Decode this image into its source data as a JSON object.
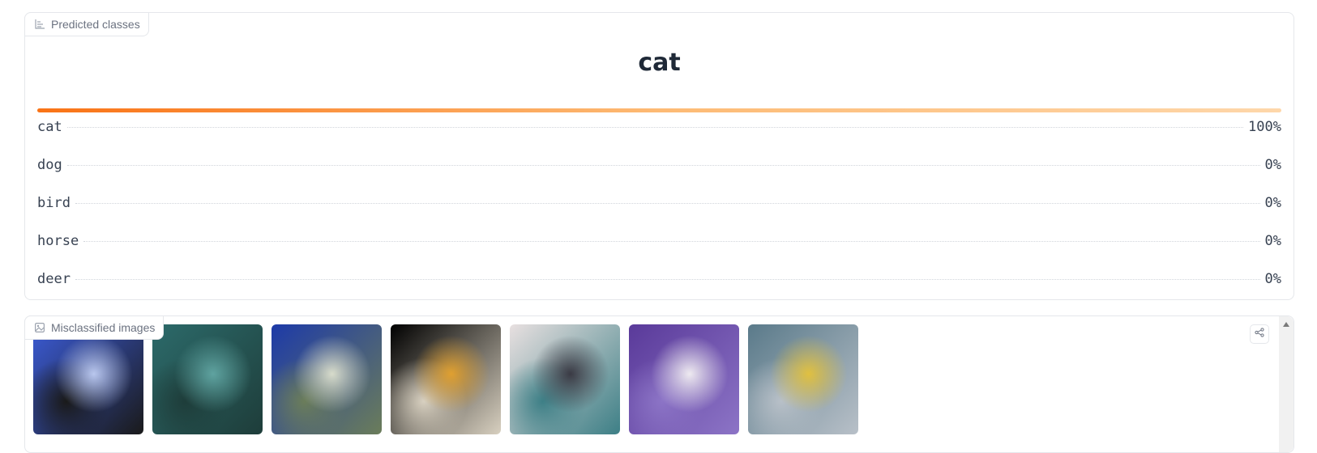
{
  "predicted": {
    "label": "Predicted classes",
    "icon": "bar-chart-icon",
    "top_class": "cat",
    "confidences": [
      {
        "label": "cat",
        "percent": "100%",
        "value": 1.0
      },
      {
        "label": "dog",
        "percent": "0%",
        "value": 0.0
      },
      {
        "label": "bird",
        "percent": "0%",
        "value": 0.0
      },
      {
        "label": "horse",
        "percent": "0%",
        "value": 0.0
      },
      {
        "label": "deer",
        "percent": "0%",
        "value": 0.0
      }
    ]
  },
  "misclassified": {
    "label": "Misclassified images",
    "icon": "image-icon",
    "share_icon": "share-icon",
    "images": [
      {
        "name": "misclassified-image-1",
        "colors": [
          "#3b5bd6",
          "#b9c7ee",
          "#1a1a1a"
        ]
      },
      {
        "name": "misclassified-image-2",
        "colors": [
          "#2c6a6a",
          "#5fa3a0",
          "#1e3d3a"
        ]
      },
      {
        "name": "misclassified-image-3",
        "colors": [
          "#1d3aa8",
          "#d8dccb",
          "#6b7d5a"
        ]
      },
      {
        "name": "misclassified-image-4",
        "colors": [
          "#000000",
          "#e0a030",
          "#d8d0c0"
        ]
      },
      {
        "name": "misclassified-image-5",
        "colors": [
          "#e8e0e0",
          "#3a3a44",
          "#3d7f86"
        ]
      },
      {
        "name": "misclassified-image-6",
        "colors": [
          "#5a3a9a",
          "#eeeaf0",
          "#8c74c6"
        ]
      },
      {
        "name": "misclassified-image-7",
        "colors": [
          "#5a7a8a",
          "#e0c040",
          "#b8c0c8"
        ]
      }
    ]
  }
}
